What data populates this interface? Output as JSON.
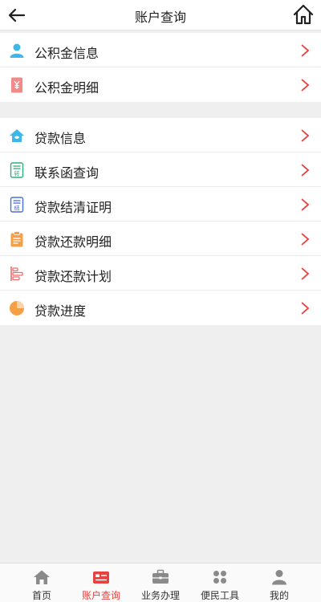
{
  "header": {
    "title": "账户查询"
  },
  "group1": [
    {
      "label": "公积金信息",
      "icon": "person-icon"
    },
    {
      "label": "公积金明细",
      "icon": "yen-card-icon"
    }
  ],
  "group2": [
    {
      "label": "贷款信息",
      "icon": "house-icon"
    },
    {
      "label": "联系函查询",
      "icon": "transfer-doc-icon",
      "badge": "转"
    },
    {
      "label": "贷款结清证明",
      "icon": "settle-doc-icon",
      "badge": "结"
    },
    {
      "label": "贷款还款明细",
      "icon": "clipboard-icon"
    },
    {
      "label": "贷款还款计划",
      "icon": "plan-bars-icon"
    },
    {
      "label": "贷款进度",
      "icon": "progress-pie-icon"
    }
  ],
  "tabs": [
    {
      "label": "首页",
      "icon": "home-icon"
    },
    {
      "label": "账户查询",
      "icon": "id-card-icon",
      "active": true
    },
    {
      "label": "业务办理",
      "icon": "briefcase-icon"
    },
    {
      "label": "便民工具",
      "icon": "grid-icon"
    },
    {
      "label": "我的",
      "icon": "user-icon"
    }
  ],
  "colors": {
    "accent": "#e64340",
    "chevron": "#e64340",
    "tab_icon": "#8a8a8a"
  }
}
